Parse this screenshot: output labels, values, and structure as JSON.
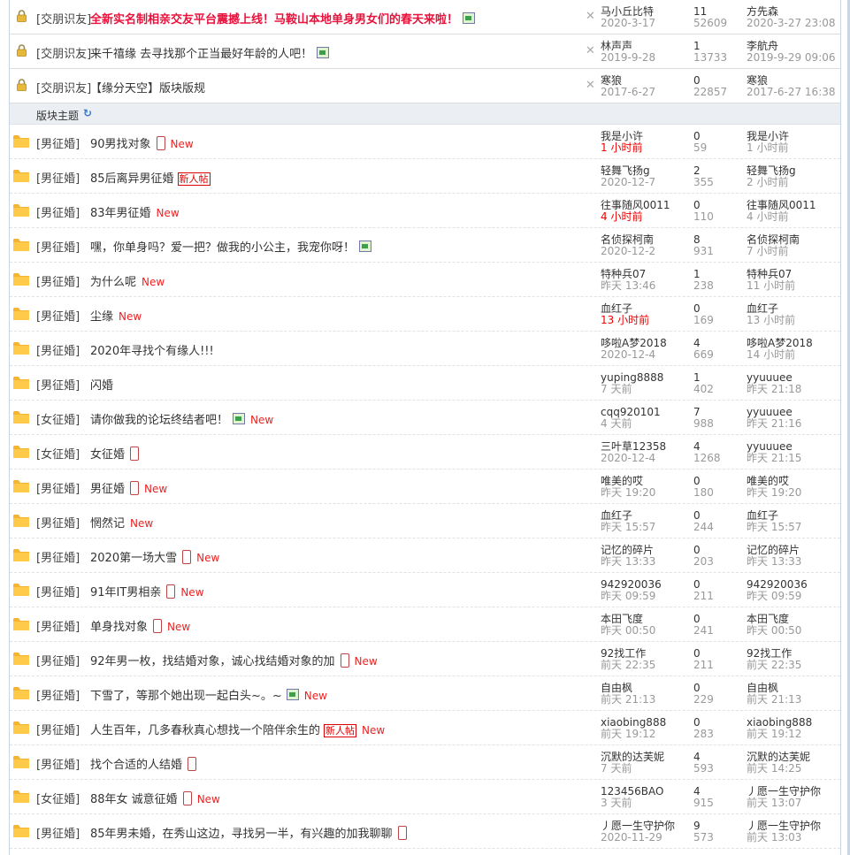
{
  "sticky": [
    {
      "category": "[交朋识友]",
      "title": "全新实名制相亲交友平台震撼上线！马鞍山本地单身男女们的春天来啦！",
      "hot": true,
      "image": true,
      "author": "马小丘比特",
      "author_date": "2020-3-17",
      "replies": "11",
      "views": "52609",
      "last_user": "方先森",
      "last_time": "2020-3-27 23:08"
    },
    {
      "category": "[交朋识友]",
      "title": "来千禧缘 去寻找那个正当最好年龄的人吧！",
      "hot": false,
      "image": true,
      "author": "林声声",
      "author_date": "2019-9-28",
      "replies": "1",
      "views": "13733",
      "last_user": "李航舟",
      "last_time": "2019-9-29 09:06"
    },
    {
      "category": "[交朋识友]",
      "title": "【缘分天空】版块版规",
      "hot": false,
      "image": false,
      "author": "寒狼",
      "author_date": "2017-6-27",
      "replies": "0",
      "views": "22857",
      "last_user": "寒狼",
      "last_time": "2017-6-27 16:38"
    }
  ],
  "section": {
    "label": "版块主题",
    "refresh_icon": "refresh-icon",
    "refresh_glyph": "↻"
  },
  "close_glyph": "✕",
  "new_label": "New",
  "new_post_label": "新人帖",
  "threads": [
    {
      "category": "[男征婚]",
      "title": "90男找对象",
      "mobile": true,
      "image": false,
      "new_badge": false,
      "new": true,
      "author": "我是小许",
      "author_date": "1 小时前",
      "author_date_red": true,
      "replies": "0",
      "views": "59",
      "last_user": "我是小许",
      "last_time": "1 小时前"
    },
    {
      "category": "[男征婚]",
      "title": "85后离异男征婚",
      "mobile": false,
      "image": false,
      "new_badge": true,
      "new": false,
      "author": "轻舞飞扬g",
      "author_date": "2020-12-7",
      "author_date_red": false,
      "replies": "2",
      "views": "355",
      "last_user": "轻舞飞扬g",
      "last_time": "2 小时前"
    },
    {
      "category": "[男征婚]",
      "title": "83年男征婚",
      "mobile": false,
      "image": false,
      "new_badge": false,
      "new": true,
      "author": "往事随风0011",
      "author_date": "4 小时前",
      "author_date_red": true,
      "replies": "0",
      "views": "110",
      "last_user": "往事随风0011",
      "last_time": "4 小时前"
    },
    {
      "category": "[男征婚]",
      "title": "嘿，你单身吗？爱一把？做我的小公主，我宠你呀！",
      "mobile": false,
      "image": true,
      "new_badge": false,
      "new": false,
      "author": "名侦探柯南",
      "author_date": "2020-12-2",
      "author_date_red": false,
      "replies": "8",
      "views": "931",
      "last_user": "名侦探柯南",
      "last_time": "7 小时前"
    },
    {
      "category": "[男征婚]",
      "title": "为什么呢",
      "mobile": false,
      "image": false,
      "new_badge": false,
      "new": true,
      "author": "特种兵07",
      "author_date": "昨天 13:46",
      "author_date_red": false,
      "replies": "1",
      "views": "238",
      "last_user": "特种兵07",
      "last_time": "11 小时前"
    },
    {
      "category": "[男征婚]",
      "title": "尘缘",
      "mobile": false,
      "image": false,
      "new_badge": false,
      "new": true,
      "author": "血红子",
      "author_date": "13 小时前",
      "author_date_red": true,
      "replies": "0",
      "views": "169",
      "last_user": "血红子",
      "last_time": "13 小时前"
    },
    {
      "category": "[男征婚]",
      "title": "2020年寻找个有缘人!!!",
      "mobile": false,
      "image": false,
      "new_badge": false,
      "new": false,
      "author": "哆啦A梦2018",
      "author_date": "2020-12-4",
      "author_date_red": false,
      "replies": "4",
      "views": "669",
      "last_user": "哆啦A梦2018",
      "last_time": "14 小时前"
    },
    {
      "category": "[男征婚]",
      "title": "闪婚",
      "mobile": false,
      "image": false,
      "new_badge": false,
      "new": false,
      "author": "yuping8888",
      "author_date": "7 天前",
      "author_date_red": false,
      "replies": "1",
      "views": "402",
      "last_user": "yyuuuee",
      "last_time": "昨天 21:18"
    },
    {
      "category": "[女征婚]",
      "title": "请你做我的论坛终结者吧！",
      "mobile": false,
      "image": true,
      "new_badge": false,
      "new": true,
      "author": "cqq920101",
      "author_date": "4 天前",
      "author_date_red": false,
      "replies": "7",
      "views": "988",
      "last_user": "yyuuuee",
      "last_time": "昨天 21:16"
    },
    {
      "category": "[女征婚]",
      "title": "女征婚",
      "mobile": true,
      "image": false,
      "new_badge": false,
      "new": false,
      "author": "三叶草12358",
      "author_date": "2020-12-4",
      "author_date_red": false,
      "replies": "4",
      "views": "1268",
      "last_user": "yyuuuee",
      "last_time": "昨天 21:15"
    },
    {
      "category": "[男征婚]",
      "title": "男征婚",
      "mobile": true,
      "image": false,
      "new_badge": false,
      "new": true,
      "author": "唯美的哎",
      "author_date": "昨天 19:20",
      "author_date_red": false,
      "replies": "0",
      "views": "180",
      "last_user": "唯美的哎",
      "last_time": "昨天 19:20"
    },
    {
      "category": "[男征婚]",
      "title": "惘然记",
      "mobile": false,
      "image": false,
      "new_badge": false,
      "new": true,
      "author": "血红子",
      "author_date": "昨天 15:57",
      "author_date_red": false,
      "replies": "0",
      "views": "244",
      "last_user": "血红子",
      "last_time": "昨天 15:57"
    },
    {
      "category": "[男征婚]",
      "title": "2020第一场大雪",
      "mobile": true,
      "image": false,
      "new_badge": false,
      "new": true,
      "author": "记忆的碎片",
      "author_date": "昨天 13:33",
      "author_date_red": false,
      "replies": "0",
      "views": "203",
      "last_user": "记忆的碎片",
      "last_time": "昨天 13:33"
    },
    {
      "category": "[男征婚]",
      "title": "91年IT男相亲",
      "mobile": true,
      "image": false,
      "new_badge": false,
      "new": true,
      "author": "942920036",
      "author_date": "昨天 09:59",
      "author_date_red": false,
      "replies": "0",
      "views": "211",
      "last_user": "942920036",
      "last_time": "昨天 09:59"
    },
    {
      "category": "[男征婚]",
      "title": "单身找对象",
      "mobile": true,
      "image": false,
      "new_badge": false,
      "new": true,
      "author": "本田飞度",
      "author_date": "昨天 00:50",
      "author_date_red": false,
      "replies": "0",
      "views": "241",
      "last_user": "本田飞度",
      "last_time": "昨天 00:50"
    },
    {
      "category": "[男征婚]",
      "title": "92年男一枚，找结婚对象，诚心找结婚对象的加",
      "mobile": true,
      "image": false,
      "new_badge": false,
      "new": true,
      "author": "92找工作",
      "author_date": "前天 22:35",
      "author_date_red": false,
      "replies": "0",
      "views": "211",
      "last_user": "92找工作",
      "last_time": "前天 22:35"
    },
    {
      "category": "[男征婚]",
      "title": "下雪了，等那个她出现一起白头~。~",
      "mobile": false,
      "image": true,
      "new_badge": false,
      "new": true,
      "author": "自由枫",
      "author_date": "前天 21:13",
      "author_date_red": false,
      "replies": "0",
      "views": "229",
      "last_user": "自由枫",
      "last_time": "前天 21:13"
    },
    {
      "category": "[男征婚]",
      "title": "人生百年，几多春秋真心想找一个陪伴余生的",
      "mobile": false,
      "image": false,
      "new_badge": true,
      "new": true,
      "author": "xiaobing888",
      "author_date": "前天 19:12",
      "author_date_red": false,
      "replies": "0",
      "views": "283",
      "last_user": "xiaobing888",
      "last_time": "前天 19:12"
    },
    {
      "category": "[男征婚]",
      "title": "找个合适的人结婚",
      "mobile": true,
      "image": false,
      "new_badge": false,
      "new": false,
      "author": "沉默的达芙妮",
      "author_date": "7 天前",
      "author_date_red": false,
      "replies": "4",
      "views": "593",
      "last_user": "沉默的达芙妮",
      "last_time": "前天 14:25"
    },
    {
      "category": "[女征婚]",
      "title": "88年女 诚意征婚",
      "mobile": true,
      "image": false,
      "new_badge": false,
      "new": true,
      "author": "123456BAO",
      "author_date": "3 天前",
      "author_date_red": false,
      "replies": "4",
      "views": "915",
      "last_user": "丿愿一生守护你",
      "last_time": "前天 13:07"
    },
    {
      "category": "[男征婚]",
      "title": "85年男未婚，在秀山这边，寻找另一半，有兴趣的加我聊聊",
      "mobile": true,
      "image": false,
      "new_badge": false,
      "new": false,
      "author": "丿愿一生守护你",
      "author_date": "2020-11-29",
      "author_date_red": false,
      "replies": "9",
      "views": "573",
      "last_user": "丿愿一生守护你",
      "last_time": "前天 13:03"
    }
  ]
}
